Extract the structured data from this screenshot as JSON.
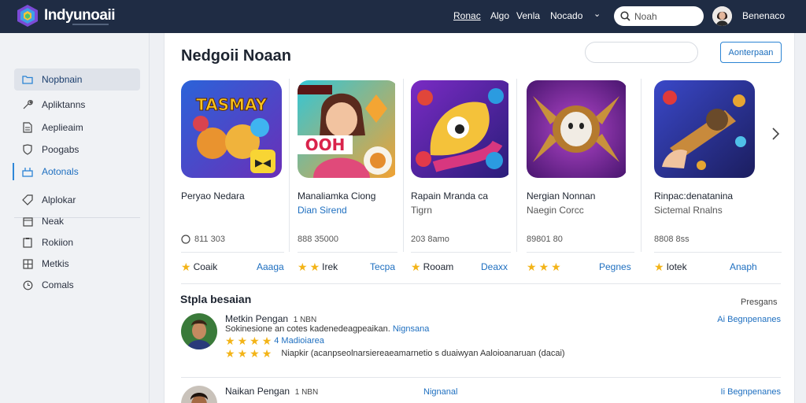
{
  "header": {
    "brand": "Indyunoaii",
    "nav": [
      "Ronac",
      "Algo",
      "Venla",
      "Nocado"
    ],
    "search_placeholder": "Noah",
    "user_name": "Benenaco"
  },
  "sidebar": {
    "items": [
      {
        "label": "Nopbnain",
        "icon": "folder-icon"
      },
      {
        "label": "Apliktanns",
        "icon": "wrench-icon"
      },
      {
        "label": "Aeplieaim",
        "icon": "document-icon"
      },
      {
        "label": "Poogabs",
        "icon": "shield-icon"
      },
      {
        "label": "Aotonals",
        "icon": "chart-icon"
      },
      {
        "label": "Alplokar",
        "icon": "tag-icon"
      },
      {
        "label": "Neak",
        "icon": "calendar-icon"
      },
      {
        "label": "Rokiion",
        "icon": "clipboard-icon"
      },
      {
        "label": "Metkis",
        "icon": "grid-icon"
      },
      {
        "label": "Comals",
        "icon": "clock-icon"
      }
    ]
  },
  "main": {
    "title": "Nedgoii Noaan",
    "action_button": "Aonterpaan",
    "cards": [
      {
        "thumb_text": "TASMAY",
        "title": "Peryao Nedara",
        "sub": "",
        "sub_blue": false,
        "size": "811 303",
        "size_icon": true,
        "rating": "Coaik",
        "link": "Aaaga"
      },
      {
        "thumb_text": "OOH",
        "title": "Manaliamka Ciong",
        "sub": "Dian Sirend",
        "sub_blue": true,
        "size": "888 35000",
        "size_icon": false,
        "rating": "Irek",
        "link": "Tecpa",
        "rating_stars": 2
      },
      {
        "thumb_text": "",
        "title": "Rapain Mranda ca",
        "sub": "Tigrn",
        "sub_blue": false,
        "size": "203 8amo",
        "size_icon": false,
        "rating": "Rooam",
        "link": "Deaxx"
      },
      {
        "thumb_text": "",
        "title": "Nergian Nonnan",
        "sub": "Naegin Corcc",
        "sub_blue": false,
        "size": "89801 80",
        "size_icon": false,
        "rating": "",
        "link": "Pegnes",
        "rating_stars": 3
      },
      {
        "thumb_text": "",
        "title": "Rinpac:denatanina",
        "sub": "Sictemal Rnalns",
        "sub_blue": false,
        "size": "8808 8ss",
        "size_icon": false,
        "rating": "Iotek",
        "link": "Anaph"
      }
    ],
    "section_title": "Stpla besaian",
    "section_right": "Presgans",
    "reviews": [
      {
        "name": "Metkin Pengan",
        "meta": "1 NBN",
        "text": "Sokinesione  an cotes kadenedeagpeaikan.",
        "tag": "Nignsana",
        "stars_line": "4  Madioiarea",
        "line2": "Niapkir (acanpseolnarsiereaeamarnetio s duaiwyan Aaloioanaruan (dacai)",
        "link": "Ai Begnpenanes"
      },
      {
        "name": "Naikan Pengan",
        "meta": "1 NBN",
        "tag": "Nignanal",
        "link": "Ii Begnpenanes"
      }
    ]
  },
  "colors": {
    "topbar": "#1f2c44",
    "accent": "#1e6fc0",
    "star": "#f3b418"
  }
}
